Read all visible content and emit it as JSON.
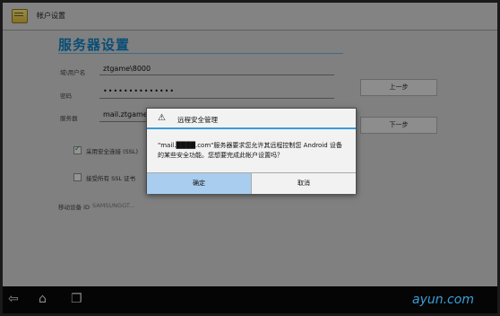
{
  "app": {
    "title": "帐户设置"
  },
  "page": {
    "title": "服务器设置"
  },
  "form": {
    "username_label": "域\\用户名",
    "username_value": "ztgame\\8000",
    "password_label": "密码",
    "password_value": "••••••••••••••",
    "server_label": "服务器",
    "server_value": "mail.ztgame.c",
    "ssl_label": "采用安全连接 (SSL)",
    "ssl_checked": true,
    "accept_all_ssl_label": "接受所有 SSL 证书",
    "accept_all_ssl_checked": false,
    "device_id_label": "移动设备 ID",
    "device_id_value": "SAMSUNGGT..."
  },
  "buttons": {
    "previous": "上一步",
    "next": "下一步"
  },
  "dialog": {
    "icon": "warning-icon",
    "title": "远程安全管理",
    "message": "\"mail.████.com\"服务器要求您允许其远程控制您 Android 设备的某些安全功能。您想要完成此帐户设置吗？",
    "ok": "确定",
    "cancel": "取消"
  },
  "nav": {
    "back_icon": "back-icon",
    "home_icon": "home-icon",
    "recent_icon": "recent-apps-icon"
  },
  "watermark": "ayun.com",
  "colors": {
    "accent": "#0e7fbf",
    "dialog_line": "#3a9ad9",
    "ok_button": "#a9cdee"
  }
}
